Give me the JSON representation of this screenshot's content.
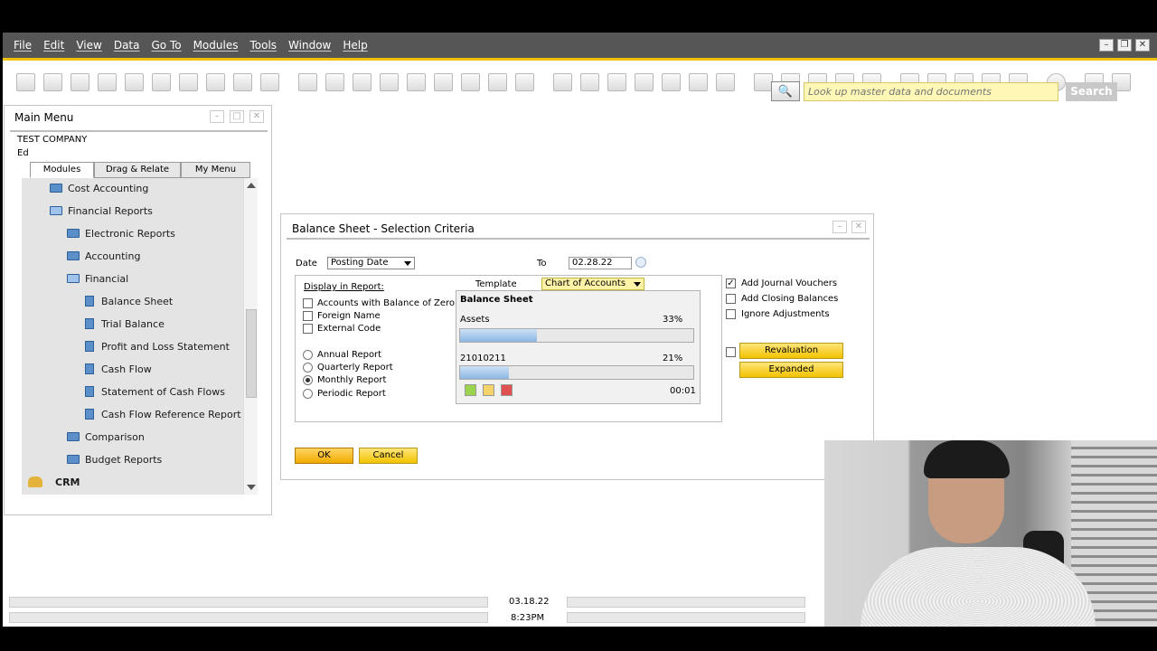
{
  "menubar": {
    "items": [
      "File",
      "Edit",
      "View",
      "Data",
      "Go To",
      "Modules",
      "Tools",
      "Window",
      "Help"
    ]
  },
  "search": {
    "placeholder": "Look up master data and documents",
    "button_label": "Search",
    "icon": "magnifier-icon"
  },
  "main_menu": {
    "title": "Main Menu",
    "company": "TEST COMPANY",
    "user": "Ed",
    "tabs": [
      "Modules",
      "Drag & Relate",
      "My Menu"
    ],
    "items": [
      {
        "label": "Cost Accounting",
        "icon": "folder-icon"
      },
      {
        "label": "Financial Reports",
        "icon": "folder-open-icon"
      },
      {
        "label": "Electronic Reports",
        "icon": "folder-icon"
      },
      {
        "label": "Accounting",
        "icon": "folder-icon"
      },
      {
        "label": "Financial",
        "icon": "folder-open-icon"
      },
      {
        "label": "Balance Sheet",
        "icon": "report-icon"
      },
      {
        "label": "Trial Balance",
        "icon": "report-icon"
      },
      {
        "label": "Profit and Loss Statement",
        "icon": "report-icon"
      },
      {
        "label": "Cash Flow",
        "icon": "report-icon"
      },
      {
        "label": "Statement of Cash Flows",
        "icon": "report-icon"
      },
      {
        "label": "Cash Flow Reference Report",
        "icon": "report-icon"
      },
      {
        "label": "Comparison",
        "icon": "folder-icon"
      },
      {
        "label": "Budget Reports",
        "icon": "folder-icon"
      },
      {
        "label": "CRM",
        "icon": "crm-icon"
      }
    ]
  },
  "dialog": {
    "title": "Balance Sheet - Selection Criteria",
    "date_label": "Date",
    "date_type": "Posting Date",
    "to_label": "To",
    "to_value": "02.28.22",
    "display_label": "Display in Report:",
    "template_label": "Template",
    "template_value": "Chart of Accounts",
    "checkboxes": [
      {
        "label": "Accounts with Balance of Zero",
        "checked": false
      },
      {
        "label": "Foreign Name",
        "checked": false
      },
      {
        "label": "External Code",
        "checked": false
      }
    ],
    "radios": [
      {
        "label": "Annual Report",
        "selected": false
      },
      {
        "label": "Quarterly Report",
        "selected": false
      },
      {
        "label": "Monthly Report",
        "selected": true
      },
      {
        "label": "Periodic Report",
        "selected": false
      }
    ],
    "right_checkboxes": [
      {
        "label": "Add Journal Vouchers",
        "checked": true
      },
      {
        "label": "Add Closing Balances",
        "checked": false
      },
      {
        "label": "Ignore Adjustments",
        "checked": false
      }
    ],
    "revaluation_label": "Revaluation",
    "expanded_label": "Expanded",
    "ok_label": "OK",
    "cancel_label": "Cancel",
    "progress": {
      "title": "Balance Sheet",
      "bar1_label": "Assets",
      "bar1_percent_text": "33%",
      "bar1_value": 33,
      "bar2_label": "21010211",
      "bar2_percent_text": "21%",
      "bar2_value": 21,
      "elapsed": "00:01"
    }
  },
  "status": {
    "date": "03.18.22",
    "time": "8:23PM"
  },
  "colors": {
    "accent": "#f2c200",
    "menubar": "#565656",
    "progress": "#8db6e2"
  }
}
